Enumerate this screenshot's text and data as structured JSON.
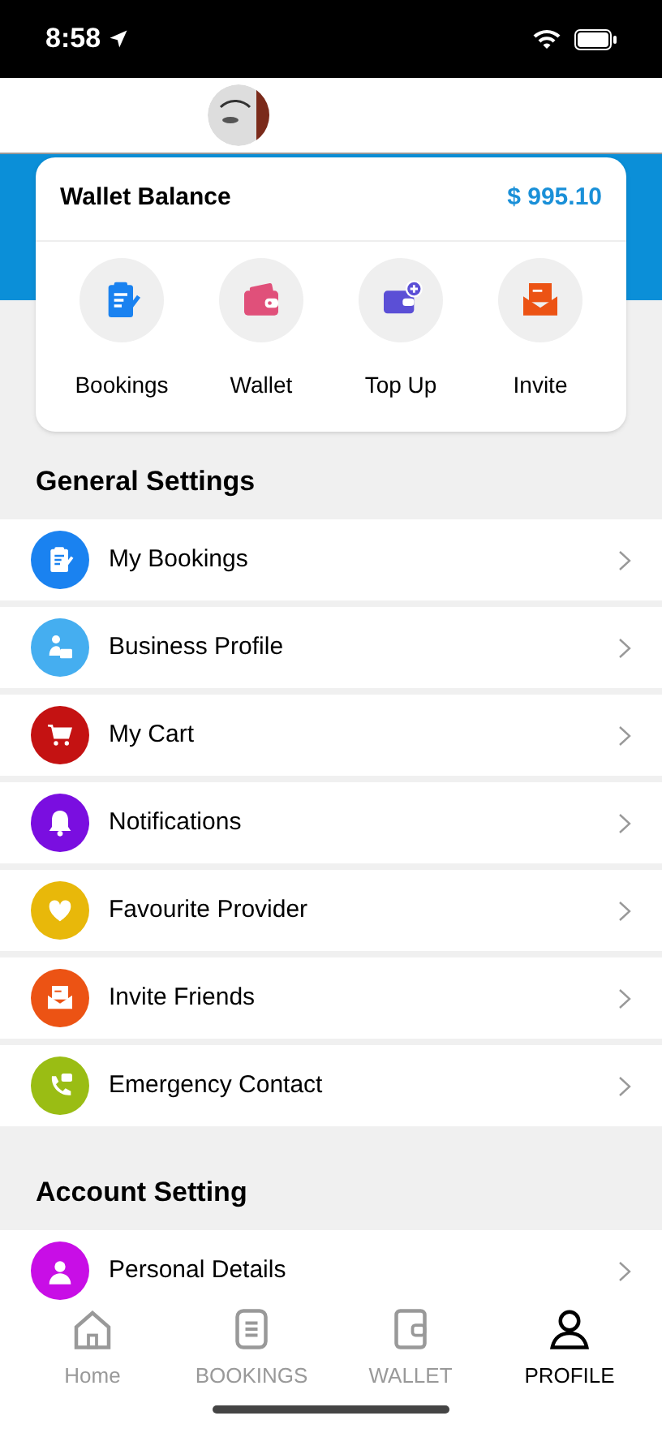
{
  "status_bar": {
    "time": "8:58"
  },
  "wallet": {
    "title": "Wallet Balance",
    "balance": "$ 995.10"
  },
  "quick_actions": [
    {
      "kind": "bookings",
      "label": "Bookings"
    },
    {
      "kind": "wallet",
      "label": "Wallet"
    },
    {
      "kind": "topup",
      "label": "Top Up"
    },
    {
      "kind": "invite",
      "label": "Invite"
    }
  ],
  "general_settings": {
    "title": "General Settings",
    "items": [
      {
        "kind": "bookings",
        "label": "My Bookings",
        "color": "#1a82f0"
      },
      {
        "kind": "business",
        "label": "Business Profile",
        "color": "#45aef0"
      },
      {
        "kind": "cart",
        "label": "My Cart",
        "color": "#c41212"
      },
      {
        "kind": "bell",
        "label": "Notifications",
        "color": "#7a0ee0"
      },
      {
        "kind": "heart",
        "label": "Favourite Provider",
        "color": "#e8b80a"
      },
      {
        "kind": "invite",
        "label": "Invite Friends",
        "color": "#ec5314"
      },
      {
        "kind": "phone",
        "label": "Emergency Contact",
        "color": "#9abd14"
      }
    ]
  },
  "account_setting": {
    "title": "Account Setting",
    "items": [
      {
        "kind": "person",
        "label": "Personal Details",
        "color": "#c80ee6"
      }
    ]
  },
  "tab_bar": [
    {
      "kind": "home",
      "label": "Home",
      "selected": false
    },
    {
      "kind": "bookings",
      "label": "BOOKINGS",
      "selected": false
    },
    {
      "kind": "wallet",
      "label": "WALLET",
      "selected": false
    },
    {
      "kind": "profile",
      "label": "PROFILE",
      "selected": true
    }
  ]
}
